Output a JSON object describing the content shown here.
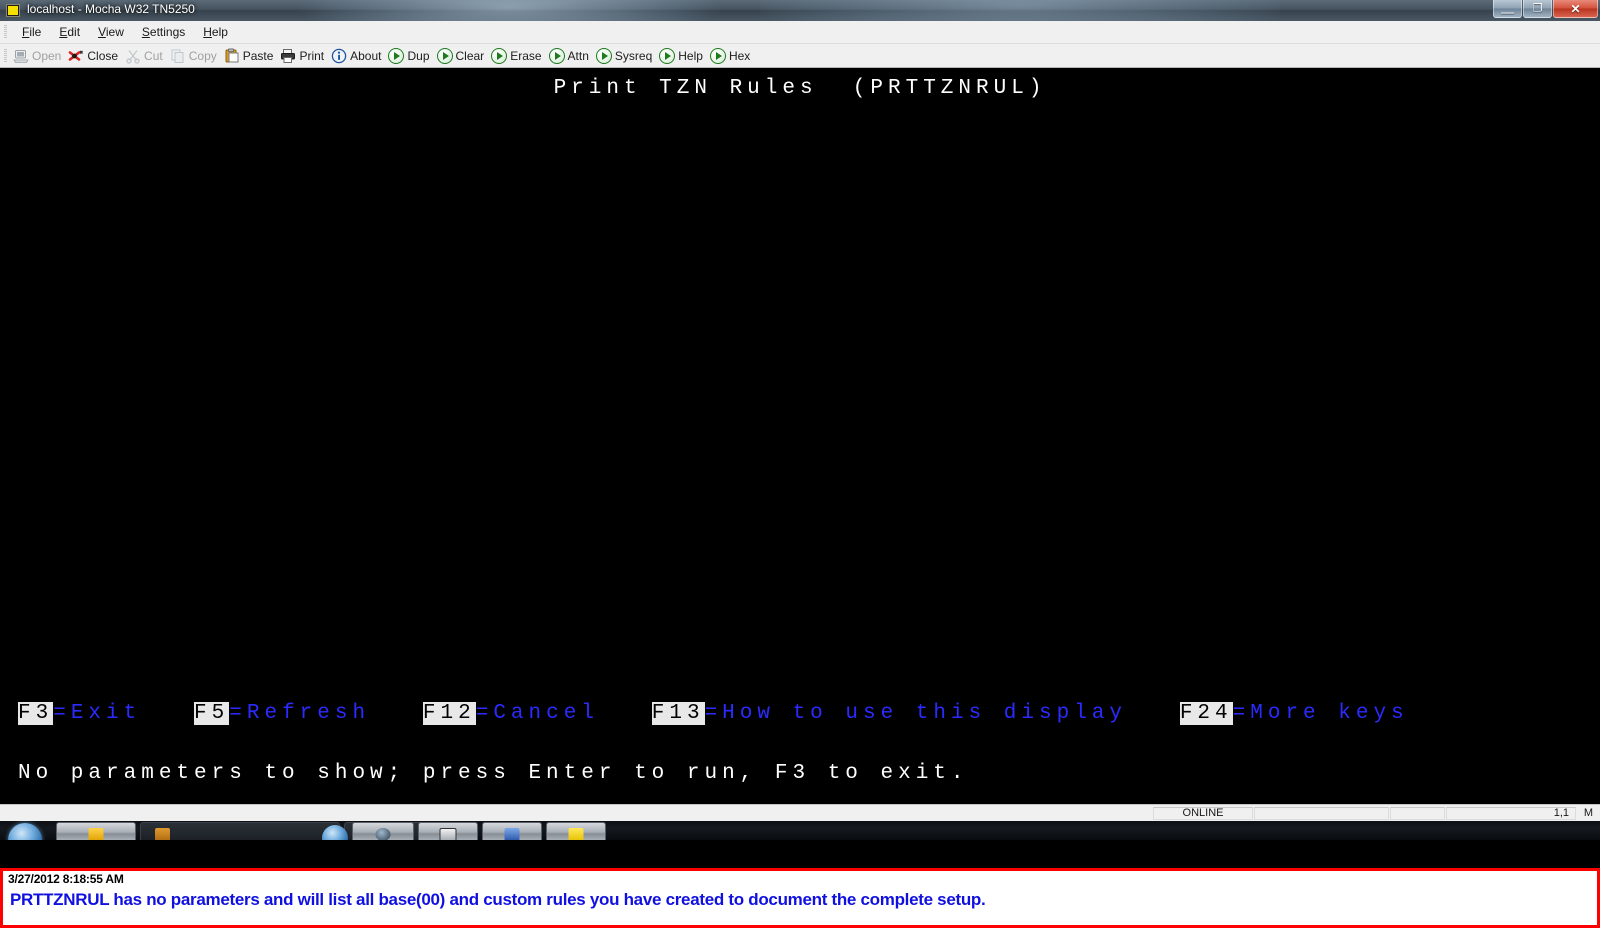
{
  "window": {
    "title": "localhost - Mocha W32 TN5250",
    "icon": "terminal-icon",
    "buttons": {
      "minimize": "—",
      "restore": "❐",
      "close": "✕"
    }
  },
  "menubar": {
    "items": [
      {
        "label": "File",
        "mnemonic": "F"
      },
      {
        "label": "Edit",
        "mnemonic": "E"
      },
      {
        "label": "View",
        "mnemonic": "V"
      },
      {
        "label": "Settings",
        "mnemonic": "S"
      },
      {
        "label": "Help",
        "mnemonic": "H"
      }
    ]
  },
  "toolbar": {
    "items": [
      {
        "label": "Open",
        "icon": "computer-icon",
        "disabled": true
      },
      {
        "label": "Close",
        "icon": "disconnect-icon",
        "disabled": false
      },
      {
        "label": "Cut",
        "icon": "scissors-icon",
        "disabled": true
      },
      {
        "label": "Copy",
        "icon": "copy-icon",
        "disabled": true
      },
      {
        "label": "Paste",
        "icon": "clipboard-icon",
        "disabled": false
      },
      {
        "label": "Print",
        "icon": "printer-icon",
        "disabled": false
      },
      {
        "label": "About",
        "icon": "info-icon",
        "disabled": false
      },
      {
        "label": "Dup",
        "icon": "play-icon",
        "disabled": false
      },
      {
        "label": "Clear",
        "icon": "play-icon",
        "disabled": false
      },
      {
        "label": "Erase",
        "icon": "play-icon",
        "disabled": false
      },
      {
        "label": "Attn",
        "icon": "play-icon",
        "disabled": false
      },
      {
        "label": "Sysreq",
        "icon": "play-icon",
        "disabled": false
      },
      {
        "label": "Help",
        "icon": "play-icon",
        "disabled": false
      },
      {
        "label": "Hex",
        "icon": "play-icon",
        "disabled": false
      }
    ]
  },
  "terminal": {
    "screen_title": "Print TZN Rules  (PRTTZNRUL)",
    "function_keys": [
      {
        "key": "F3",
        "desc": "=Exit"
      },
      {
        "key": "F5",
        "desc": "=Refresh"
      },
      {
        "key": "F12",
        "desc": "=Cancel"
      },
      {
        "key": "F13",
        "desc": "=How to use this display"
      },
      {
        "key": "F24",
        "desc": "=More keys"
      }
    ],
    "message": "No parameters to show; press Enter to run, F3 to exit.",
    "colors": {
      "background": "#000000",
      "text": "#ffffff",
      "fkey_text": "#2b2bff",
      "fkey_highlight_bg": "#e8e8e8"
    }
  },
  "statusbar": {
    "connection": "ONLINE",
    "pane2": "",
    "pane3": "",
    "cursor_position": "1,1",
    "mode": "M"
  },
  "annotation": {
    "timestamp": "3/27/2012 8:18:55 AM",
    "text": "PRTTZNRUL has no parameters and will list all base(00) and custom rules you have created to document the complete setup.",
    "border_color": "#ff0000",
    "text_color": "#1010e0"
  }
}
